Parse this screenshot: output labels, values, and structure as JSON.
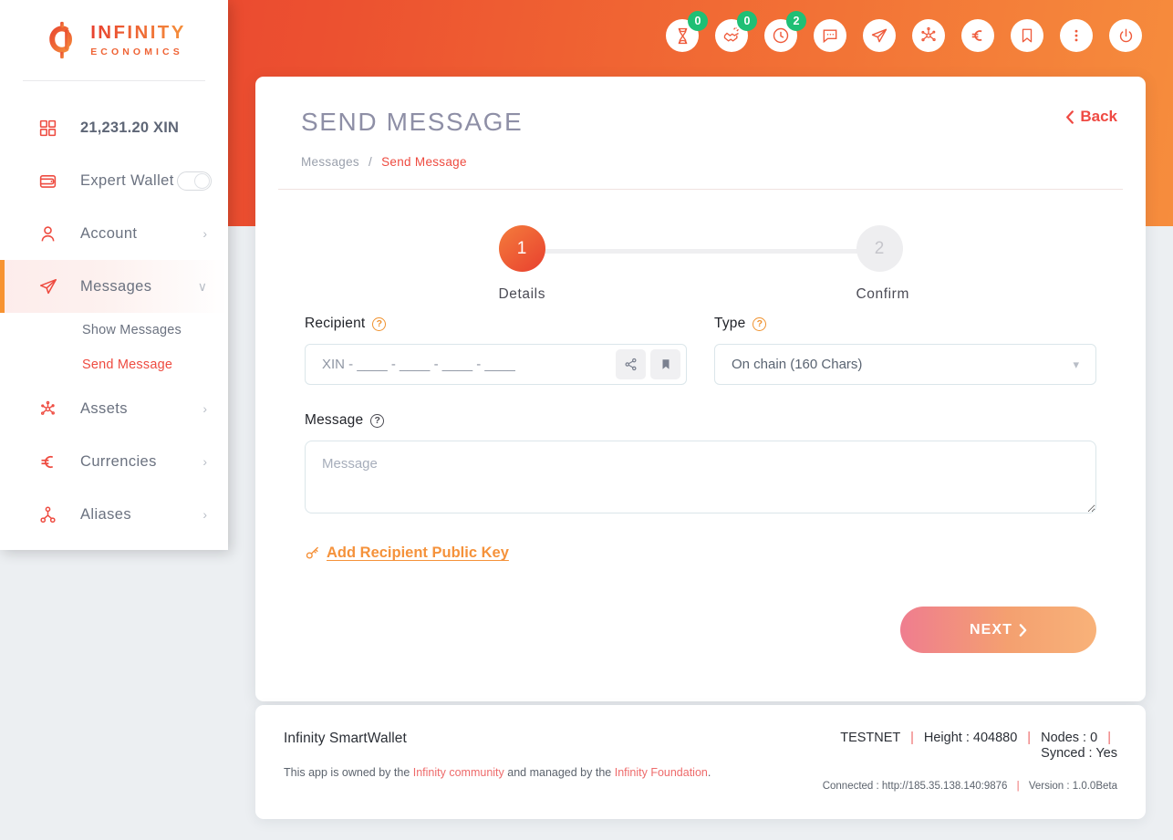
{
  "brand": {
    "title": "INFINITY",
    "subtitle": "ECONOMICS"
  },
  "sidebar": {
    "balance": "21,231.20 XIN",
    "balance_icon": "grid-icon",
    "expert_wallet": {
      "label": "Expert Wallet",
      "icon": "wallet-icon",
      "enabled": false
    },
    "items": [
      {
        "label": "Account",
        "icon": "user-icon",
        "caret": "›",
        "active": false
      },
      {
        "label": "Messages",
        "icon": "paper-plane-icon",
        "caret": "∨",
        "active": true
      },
      {
        "label": "Assets",
        "icon": "assets-icon",
        "caret": "›",
        "active": false
      },
      {
        "label": "Currencies",
        "icon": "euro-icon",
        "caret": "›",
        "active": false
      },
      {
        "label": "Aliases",
        "icon": "alias-node-icon",
        "caret": "›",
        "active": false
      }
    ],
    "submenu": [
      {
        "label": "Show Messages",
        "current": false
      },
      {
        "label": "Send Message",
        "current": true
      }
    ]
  },
  "toolbar": {
    "buttons": [
      {
        "icon": "hourglass-icon",
        "badge": "0"
      },
      {
        "icon": "handshake-icon",
        "badge": "0"
      },
      {
        "icon": "clock-icon",
        "badge": "2"
      },
      {
        "icon": "chat-bubble-icon",
        "badge": null
      },
      {
        "icon": "paper-plane-icon",
        "badge": null
      },
      {
        "icon": "assets-icon",
        "badge": null
      },
      {
        "icon": "euro-icon",
        "badge": null
      },
      {
        "icon": "bookmark-icon",
        "badge": null
      },
      {
        "icon": "more-vertical-icon",
        "badge": null
      },
      {
        "icon": "power-icon",
        "badge": null
      }
    ],
    "badge_color": "#1fbf75"
  },
  "page": {
    "title": "SEND MESSAGE",
    "back_label": "Back",
    "back_icon": "chevron-left-icon",
    "breadcrumb": {
      "parent": "Messages",
      "separator": "/",
      "current": "Send Message"
    }
  },
  "stepper": {
    "steps": [
      {
        "number": "1",
        "label": "Details",
        "state": "active"
      },
      {
        "number": "2",
        "label": "Confirm",
        "state": "inactive"
      }
    ]
  },
  "form": {
    "recipient": {
      "label": "Recipient",
      "help_icon": "question-circle-icon",
      "value": "",
      "placeholder": "XIN - ____ - ____ - ____ - ____",
      "buttons": [
        {
          "icon": "share-icon"
        },
        {
          "icon": "bookmark-icon"
        }
      ]
    },
    "type": {
      "label": "Type",
      "help_icon": "question-circle-icon",
      "selected": "On chain (160 Chars)",
      "caret_icon": "chevron-down-icon"
    },
    "message": {
      "label": "Message",
      "help_icon": "question-circle-icon",
      "value": "",
      "placeholder": "Message"
    },
    "add_public_key": {
      "label": " Add Recipient Public Key",
      "icon": "key-icon"
    },
    "next_button": {
      "label": "NEXT",
      "icon": "chevron-right-icon"
    }
  },
  "footer": {
    "app_name": "Infinity SmartWallet",
    "ownership": {
      "pre": "This app is owned by the ",
      "link1": "Infinity community",
      "mid": " and managed by the ",
      "link2": "Infinity Foundation",
      "post": "."
    },
    "network": "TESTNET",
    "height_label": "Height : 404880",
    "nodes_label": "Nodes : 0",
    "synced_label": "Synced : Yes",
    "connected_label": "Connected : http://185.35.138.140:9876",
    "version_label": "Version : 1.0.0Beta",
    "separator": "|"
  },
  "colors": {
    "brand_red": "#e8402f",
    "brand_orange": "#f5873a",
    "accent_link": "#f5923b",
    "badge_green": "#1fbf75",
    "page_bg": "#eceff2"
  }
}
